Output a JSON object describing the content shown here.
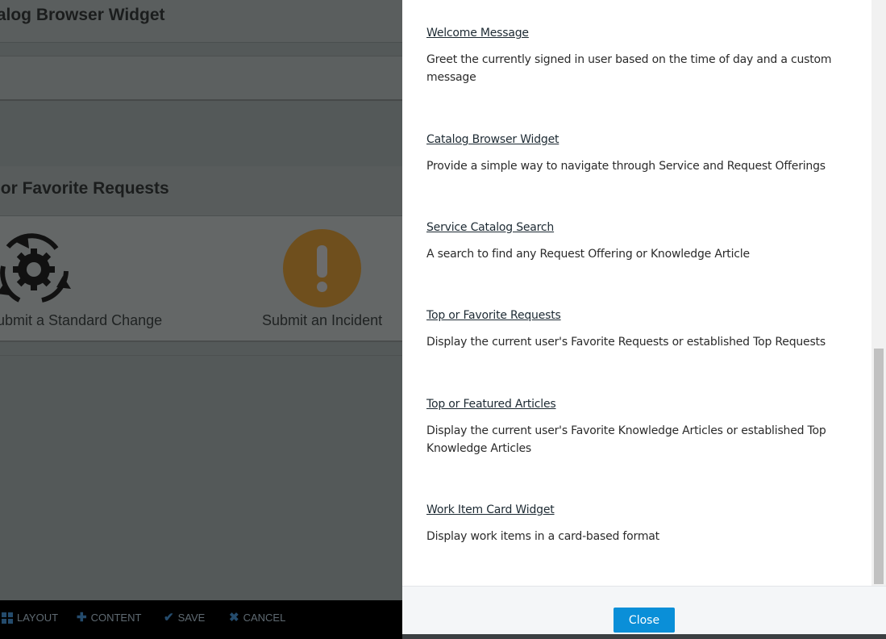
{
  "background": {
    "section_title": "Catalog Browser Widget",
    "favorites_title": "Top or Favorite Requests",
    "tiles": [
      {
        "label": "Submit a Standard Change",
        "icon": "gear-cycle-icon"
      },
      {
        "label": "Submit an Incident",
        "icon": "exclamation-icon"
      }
    ]
  },
  "toolbar": {
    "items": [
      {
        "label": "LAYOUT",
        "icon": "grid-icon"
      },
      {
        "label": "CONTENT",
        "icon": "plus-icon"
      },
      {
        "label": "SAVE",
        "icon": "check-icon"
      },
      {
        "label": "CANCEL",
        "icon": "x-icon"
      }
    ]
  },
  "panel": {
    "widgets": [
      {
        "title": "Welcome Message",
        "description": "Greet the currently signed in user based on the time of day and a custom message"
      },
      {
        "title": "Catalog Browser Widget",
        "description": "Provide a simple way to navigate through Service and Request Offerings"
      },
      {
        "title": "Service Catalog Search",
        "description": "A search to find any Request Offering or Knowledge Article"
      },
      {
        "title": "Top or Favorite Requests",
        "description": "Display the current user's Favorite Requests or established Top Requests"
      },
      {
        "title": "Top or Featured Articles",
        "description": "Display the current user's Favorite Knowledge Articles or established Top Knowledge Articles"
      },
      {
        "title": "Work Item Card Widget",
        "description": "Display work items in a card-based format"
      }
    ],
    "close_label": "Close"
  },
  "colors": {
    "accent": "#0a8fd8",
    "overlay": "#545959",
    "toolbar_bg": "#000000",
    "toolbar_icon": "#244b6c"
  }
}
